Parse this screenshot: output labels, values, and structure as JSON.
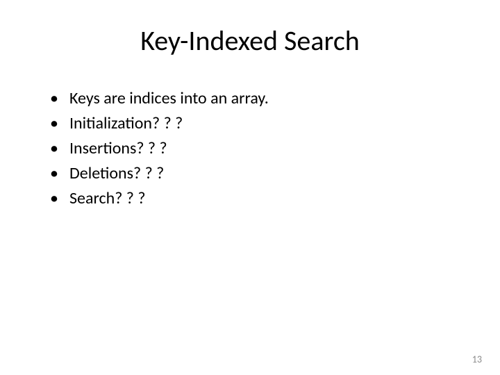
{
  "slide": {
    "title": "Key-Indexed Search",
    "bullets": [
      "Keys are indices into an array.",
      "Initialization? ? ?",
      "Insertions? ? ?",
      "Deletions? ? ?",
      "Search? ? ?"
    ],
    "page_number": "13"
  }
}
